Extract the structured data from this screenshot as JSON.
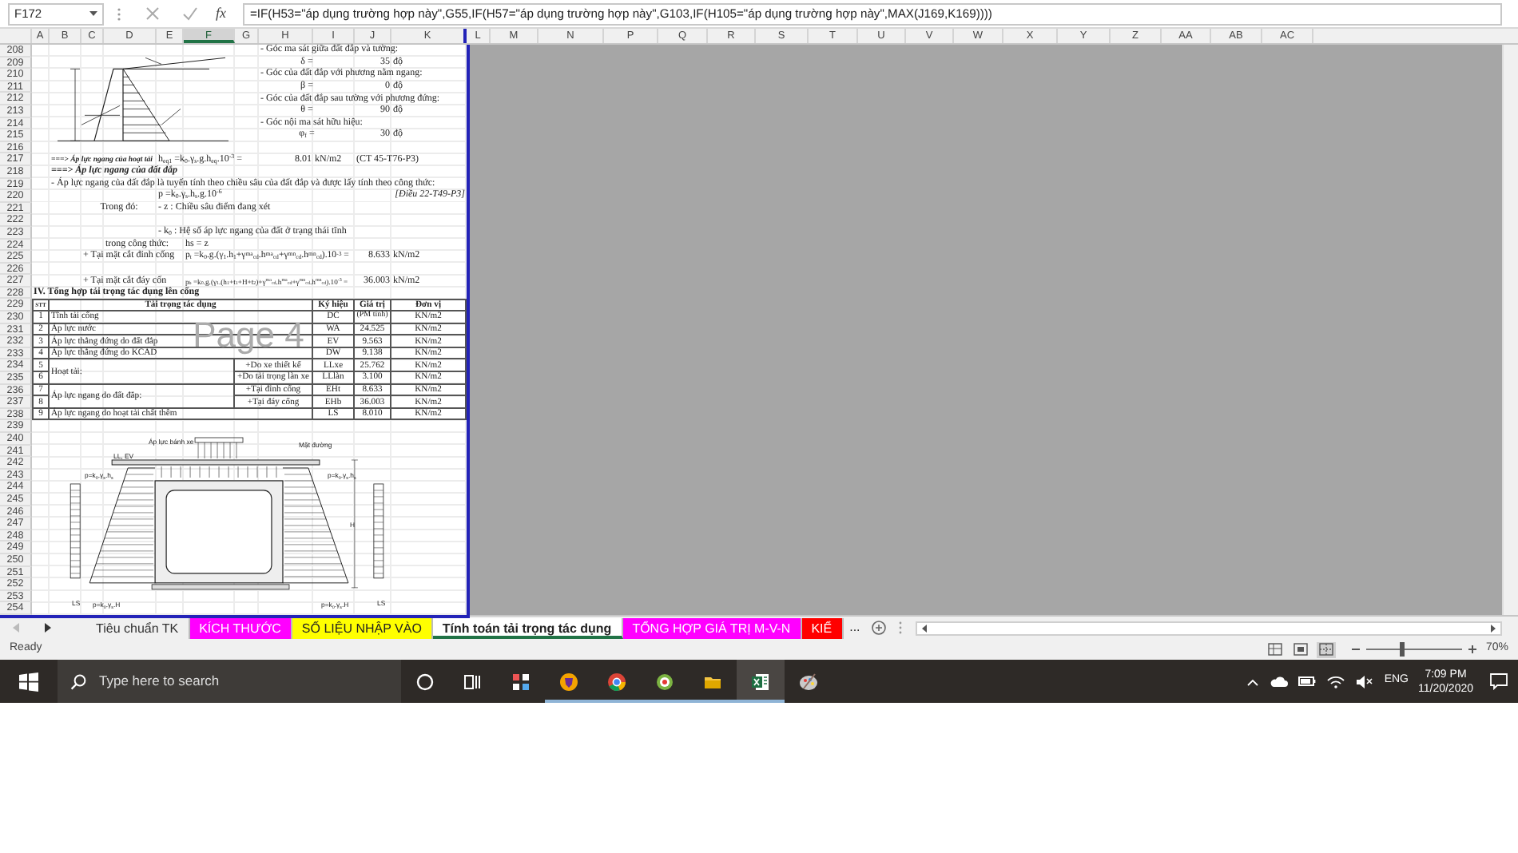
{
  "formula_bar": {
    "name_box": "F172",
    "function_label": "fx",
    "formula": "=IF(H53=\"áp dụng trường hợp này\",G55,IF(H57=\"áp dụng trường hợp này\",G103,IF(H105=\"áp dụng trường hợp này\",MAX(J169,K169))))"
  },
  "columns": [
    {
      "label": "A",
      "selected": false
    },
    {
      "label": "B",
      "selected": false
    },
    {
      "label": "C",
      "selected": false
    },
    {
      "label": "D",
      "selected": false
    },
    {
      "label": "E",
      "selected": false
    },
    {
      "label": "F",
      "selected": true
    },
    {
      "label": "G",
      "selected": false
    },
    {
      "label": "H",
      "selected": false
    },
    {
      "label": "I",
      "selected": false
    },
    {
      "label": "J",
      "selected": false
    },
    {
      "label": "K",
      "selected": false
    },
    {
      "label": "L",
      "selected": false
    },
    {
      "label": "M",
      "selected": false
    },
    {
      "label": "N",
      "selected": false
    },
    {
      "label": "P",
      "selected": false
    },
    {
      "label": "Q",
      "selected": false
    },
    {
      "label": "R",
      "selected": false
    },
    {
      "label": "S",
      "selected": false
    },
    {
      "label": "T",
      "selected": false
    },
    {
      "label": "U",
      "selected": false
    },
    {
      "label": "V",
      "selected": false
    },
    {
      "label": "W",
      "selected": false
    },
    {
      "label": "X",
      "selected": false
    },
    {
      "label": "Y",
      "selected": false
    },
    {
      "label": "Z",
      "selected": false
    },
    {
      "label": "AA",
      "selected": false
    },
    {
      "label": "AB",
      "selected": false
    },
    {
      "label": "AC",
      "selected": false
    }
  ],
  "rows": [
    {
      "number": "208",
      "cells": {
        "H": {
          "text": "- Góc ma sát giữa đất đắp và tường:"
        }
      }
    },
    {
      "number": "209",
      "cells": {
        "H": {
          "text": "δ =",
          "kind": "symbol"
        },
        "J": {
          "text": "35",
          "kind": "value"
        },
        "K": {
          "text": "độ"
        }
      }
    },
    {
      "number": "210",
      "cells": {
        "H": {
          "text": "- Góc của đất đắp với phương nằm ngang:"
        }
      }
    },
    {
      "number": "211",
      "cells": {
        "H": {
          "text": "β =",
          "kind": "symbol"
        },
        "J": {
          "text": "0",
          "kind": "value"
        },
        "K": {
          "text": "độ"
        }
      }
    },
    {
      "number": "212",
      "cells": {
        "H": {
          "text": "- Góc của đất đắp sau tường với phương đứng:"
        }
      }
    },
    {
      "number": "213",
      "cells": {
        "H": {
          "text": "θ =",
          "kind": "symbol"
        },
        "J": {
          "text": "90",
          "kind": "value"
        },
        "K": {
          "text": "độ"
        }
      }
    },
    {
      "number": "214",
      "cells": {
        "H": {
          "text": "- Góc nội ma sát hữu hiệu:"
        }
      }
    },
    {
      "number": "215",
      "cells": {
        "H": {
          "text": "φ$_{f}$ =",
          "kind": "symbol"
        },
        "J": {
          "text": "30",
          "kind": "value"
        },
        "K": {
          "text": "độ"
        }
      }
    },
    {
      "number": "216",
      "cells": {}
    },
    {
      "number": "217",
      "cells": {
        "B": {
          "text": "===> Áp lực ngang của hoạt tải",
          "kind": "heading"
        },
        "E": {
          "text": "h$_{eq1}$ =k$_{0}$.γ$_{s}$.g.h$_{eq}$.10$^{-3}$ ="
        },
        "H": {
          "text": "8.01",
          "kind": "value"
        },
        "I": {
          "text": "kN/m2"
        },
        "J": {
          "text": "(CT 45-T76-P3)"
        }
      }
    },
    {
      "number": "218",
      "cells": {
        "B": {
          "text": "===> Áp lực ngang của đất đắp",
          "kind": "heading"
        }
      }
    },
    {
      "number": "219",
      "cells": {
        "B": {
          "text": "- Áp lực ngang của đất đắp là tuyến tính theo chiều sâu của đất đắp và được lấy tính theo công thức:"
        }
      }
    },
    {
      "number": "220",
      "cells": {
        "E": {
          "text": "p =k$_{0}$.γ$_{s}$.h$_{s}$.g.10$^{-6}$"
        },
        "K": {
          "text": "[Điều 22-T49-P3]",
          "kind": "note"
        }
      }
    },
    {
      "number": "221",
      "cells": {
        "C": {
          "text": "Trong đó:",
          "kind": "symbol"
        },
        "E": {
          "text": "- z : Chiều sâu điểm đang xét"
        }
      }
    },
    {
      "number": "222",
      "cells": {}
    },
    {
      "number": "223",
      "cells": {
        "E": {
          "text": "- k$_{0}$ : Hệ số áp lực ngang của đất ở trạng thái tĩnh"
        }
      }
    },
    {
      "number": "224",
      "cells": {
        "D": {
          "text": "trong công thức:"
        },
        "F": {
          "text": "hs = z"
        }
      }
    },
    {
      "number": "225",
      "cells": {
        "C": {
          "text": "+ Tại mặt cắt đỉnh cống"
        },
        "F": {
          "text": "p$_{t}$ =k$_{0}$.g.(γ$_{1}$.h$_{1}$+γ$^{ma}$$_{cd}$.h$^{ma}$$_{cd}$+γ$^{mn}$$_{cd}$.h$^{mn}$$_{cd}$).10$^{-3}$ ="
        },
        "J": {
          "text": "8.633",
          "kind": "value"
        },
        "K": {
          "text": "kN/m2"
        }
      }
    },
    {
      "number": "226",
      "cells": {}
    },
    {
      "number": "227",
      "cells": {
        "C": {
          "text": "+ Tại mặt cắt đáy cốn"
        },
        "F": {
          "text": "p$_{b}$ =k$_{0}$.g.(γ$_{1}$.(h$_{1}$+t$_{1}$+H+t$_{2}$)+γ$^{ma}$$_{cd}$.h$^{ma}$$_{cd}$+γ$^{mn}$$_{cd}$.h$^{mn}$$_{cd}$).10$^{-3}$ ="
        },
        "J": {
          "text": "36.003",
          "kind": "value"
        },
        "K": {
          "text": "kN/m2"
        }
      }
    },
    {
      "number": "228",
      "cells": {
        "A": {
          "text": "IV. Tổng hợp tải trọng tác dụng lên cống",
          "kind": "section"
        }
      }
    },
    {
      "number": "229",
      "cells": {
        "A": {
          "text": "STT",
          "kind": "header"
        },
        "B": {
          "text": "Tải trọng tác dụng",
          "kind": "header"
        },
        "I": {
          "text": "Ký hiệu",
          "kind": "header"
        },
        "J": {
          "text": "Giá trị",
          "kind": "header"
        },
        "K": {
          "text": "Đơn vị",
          "kind": "header"
        }
      }
    },
    {
      "number": "230",
      "cells": {
        "A": {
          "text": "1",
          "kind": "table"
        },
        "B": {
          "text": "Tĩnh tải cống",
          "kind": "table"
        },
        "I": {
          "text": "DC",
          "kind": "table"
        },
        "J": {
          "text": "(PM tính)",
          "kind": "table"
        },
        "K": {
          "text": "KN/m2",
          "kind": "table"
        }
      }
    },
    {
      "number": "231",
      "cells": {
        "A": {
          "text": "2",
          "kind": "table"
        },
        "B": {
          "text": "Áp lực nước",
          "kind": "table"
        },
        "I": {
          "text": "WA",
          "kind": "table"
        },
        "J": {
          "text": "24.525",
          "kind": "table"
        },
        "K": {
          "text": "KN/m2",
          "kind": "table"
        }
      }
    },
    {
      "number": "232",
      "cells": {
        "A": {
          "text": "3",
          "kind": "table"
        },
        "B": {
          "text": "Áp lực thẳng đứng do đất đắp",
          "kind": "table"
        },
        "I": {
          "text": "EV",
          "kind": "table"
        },
        "J": {
          "text": "9.563",
          "kind": "table"
        },
        "K": {
          "text": "KN/m2",
          "kind": "table"
        }
      }
    },
    {
      "number": "233",
      "cells": {
        "A": {
          "text": "4",
          "kind": "table"
        },
        "B": {
          "text": "Áp lực thẳng đứng do KCAD",
          "kind": "table"
        },
        "I": {
          "text": "DW",
          "kind": "table"
        },
        "J": {
          "text": "9.138",
          "kind": "table"
        },
        "K": {
          "text": "KN/m2",
          "kind": "table"
        }
      }
    },
    {
      "number": "234",
      "cells": {
        "A": {
          "text": "5",
          "kind": "table"
        },
        "B": {
          "text": "Hoạt tải:",
          "kind": "merged"
        },
        "G": {
          "text": "+Do xe thiết kế",
          "kind": "table"
        },
        "I": {
          "text": "LLxe",
          "kind": "table"
        },
        "J": {
          "text": "25.762",
          "kind": "table"
        },
        "K": {
          "text": "KN/m2",
          "kind": "table"
        }
      }
    },
    {
      "number": "235",
      "cells": {
        "A": {
          "text": "6",
          "kind": "table"
        },
        "G": {
          "text": "+Do tải trọng làn xe",
          "kind": "table"
        },
        "I": {
          "text": "LLlàn",
          "kind": "table"
        },
        "J": {
          "text": "3.100",
          "kind": "table"
        },
        "K": {
          "text": "KN/m2",
          "kind": "table"
        }
      }
    },
    {
      "number": "236",
      "cells": {
        "A": {
          "text": "7",
          "kind": "table"
        },
        "B": {
          "text": "Áp lực ngang do đất đắp:",
          "kind": "merged"
        },
        "G": {
          "text": "+Tại đỉnh cống",
          "kind": "table"
        },
        "I": {
          "text": "EHt",
          "kind": "table"
        },
        "J": {
          "text": "8.633",
          "kind": "table"
        },
        "K": {
          "text": "KN/m2",
          "kind": "table"
        }
      }
    },
    {
      "number": "237",
      "cells": {
        "A": {
          "text": "8",
          "kind": "table"
        },
        "G": {
          "text": "+Tại đáy cống",
          "kind": "table"
        },
        "I": {
          "text": "EHb",
          "kind": "table"
        },
        "J": {
          "text": "36.003",
          "kind": "table"
        },
        "K": {
          "text": "KN/m2",
          "kind": "table"
        }
      }
    },
    {
      "number": "238",
      "cells": {
        "A": {
          "text": "9",
          "kind": "table"
        },
        "B": {
          "text": "Áp lực ngang do hoạt tải chất thêm",
          "kind": "table"
        },
        "I": {
          "text": "LS",
          "kind": "table"
        },
        "J": {
          "text": "8.010",
          "kind": "table"
        },
        "K": {
          "text": "KN/m2",
          "kind": "table"
        }
      }
    },
    {
      "number": "239",
      "cells": {}
    },
    {
      "number": "240",
      "cells": {}
    },
    {
      "number": "241",
      "cells": {}
    },
    {
      "number": "242",
      "cells": {}
    },
    {
      "number": "243",
      "cells": {}
    },
    {
      "number": "244",
      "cells": {}
    },
    {
      "number": "245",
      "cells": {}
    },
    {
      "number": "246",
      "cells": {}
    },
    {
      "number": "247",
      "cells": {}
    },
    {
      "number": "248",
      "cells": {}
    },
    {
      "number": "249",
      "cells": {}
    },
    {
      "number": "250",
      "cells": {}
    },
    {
      "number": "251",
      "cells": {}
    },
    {
      "number": "252",
      "cells": {}
    },
    {
      "number": "253",
      "cells": {}
    },
    {
      "number": "254",
      "cells": {}
    }
  ],
  "page_label": "Page 4",
  "culvert_labels": [
    {
      "text": "Áp lực bánh xe"
    },
    {
      "text": "Mặt đường"
    },
    {
      "text": "LL, EV"
    },
    {
      "text": "p=k$_{0}$.γ$_{s}$.h$_{s}$"
    },
    {
      "text": "p=k$_{0}$.γ$_{s}$.h$_{s}$"
    },
    {
      "text": "H"
    },
    {
      "text": "LS"
    },
    {
      "text": "p=k$_{0}$.γ$_{s}$.H"
    },
    {
      "text": "p=k$_{0}$.γ$_{s}$.H"
    },
    {
      "text": "LS"
    }
  ],
  "sheet_tabs": {
    "nav": [
      {
        "disabled": true
      },
      {
        "disabled": false
      }
    ],
    "tabs": [
      {
        "label": "Tiêu chuẩn TK",
        "selected": false
      },
      {
        "label": "KÍCH THƯỚC",
        "selected": false,
        "color": "#ff00ff"
      },
      {
        "label": "SỐ LIỆU NHẬP VÀO",
        "selected": false,
        "color": "#ffff00"
      },
      {
        "label": "Tính toán tải trọng tác dụng",
        "selected": true
      },
      {
        "label": "TỔNG HỢP GIÁ TRỊ M-V-N",
        "selected": false,
        "color": "#ff00ff"
      },
      {
        "label": "KIỂ",
        "selected": false,
        "color": "#ff0000"
      }
    ],
    "more": "..."
  },
  "status_bar": {
    "text": "Ready",
    "views": [
      {
        "kind": "normal",
        "selected": false
      },
      {
        "kind": "layout",
        "selected": false
      },
      {
        "kind": "pagebreak",
        "selected": true
      }
    ],
    "zoom": {
      "level": 0.37,
      "reading": "70%"
    }
  },
  "taskbar": {
    "search_placeholder": "Type here to search",
    "apps": [
      {
        "kind": "cortana",
        "running": false,
        "selected": false
      },
      {
        "kind": "taskview",
        "running": false,
        "selected": false
      },
      {
        "kind": "grid",
        "running": false,
        "selected": false
      },
      {
        "kind": "shield",
        "running": true,
        "selected": false
      },
      {
        "kind": "browser",
        "running": true,
        "selected": false
      },
      {
        "kind": "target",
        "running": true,
        "selected": false
      },
      {
        "kind": "folder",
        "running": true,
        "selected": false
      },
      {
        "kind": "sheet",
        "running": true,
        "selected": true
      },
      {
        "kind": "palette",
        "running": false,
        "selected": false
      }
    ],
    "language": "ENG",
    "time": "7:09 PM",
    "date": "11/20/2020"
  }
}
